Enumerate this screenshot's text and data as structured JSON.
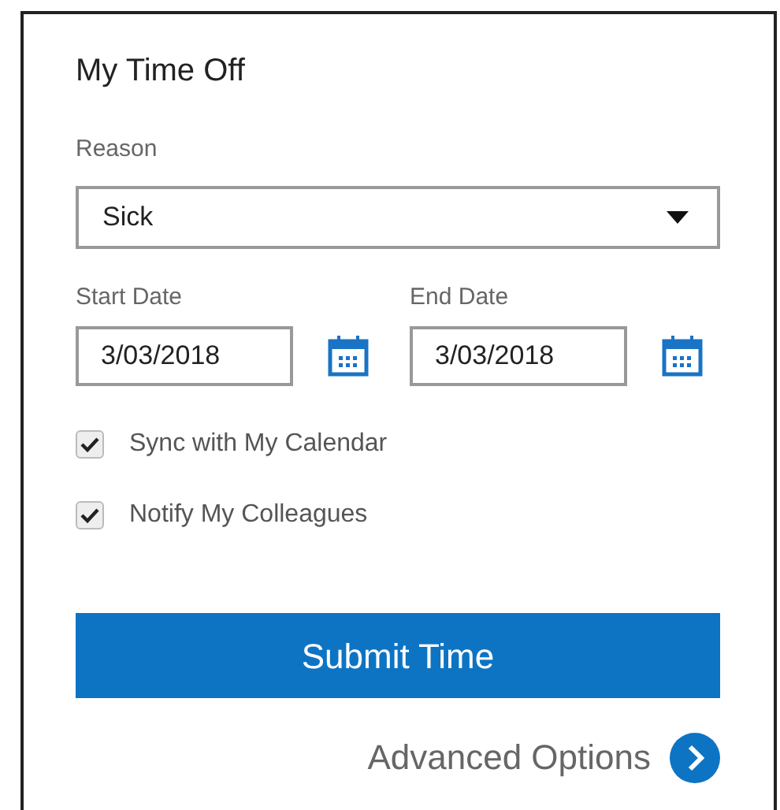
{
  "title": "My Time Off",
  "reason": {
    "label": "Reason",
    "value": "Sick"
  },
  "dates": [
    {
      "label": "Start Date",
      "value": "3/03/2018"
    },
    {
      "label": "End Date",
      "value": "3/03/2018"
    }
  ],
  "options": [
    {
      "label": "Sync with My Calendar",
      "checked": true
    },
    {
      "label": "Notify My Colleagues",
      "checked": true
    }
  ],
  "submit": "Submit Time",
  "advanced": "Advanced Options"
}
